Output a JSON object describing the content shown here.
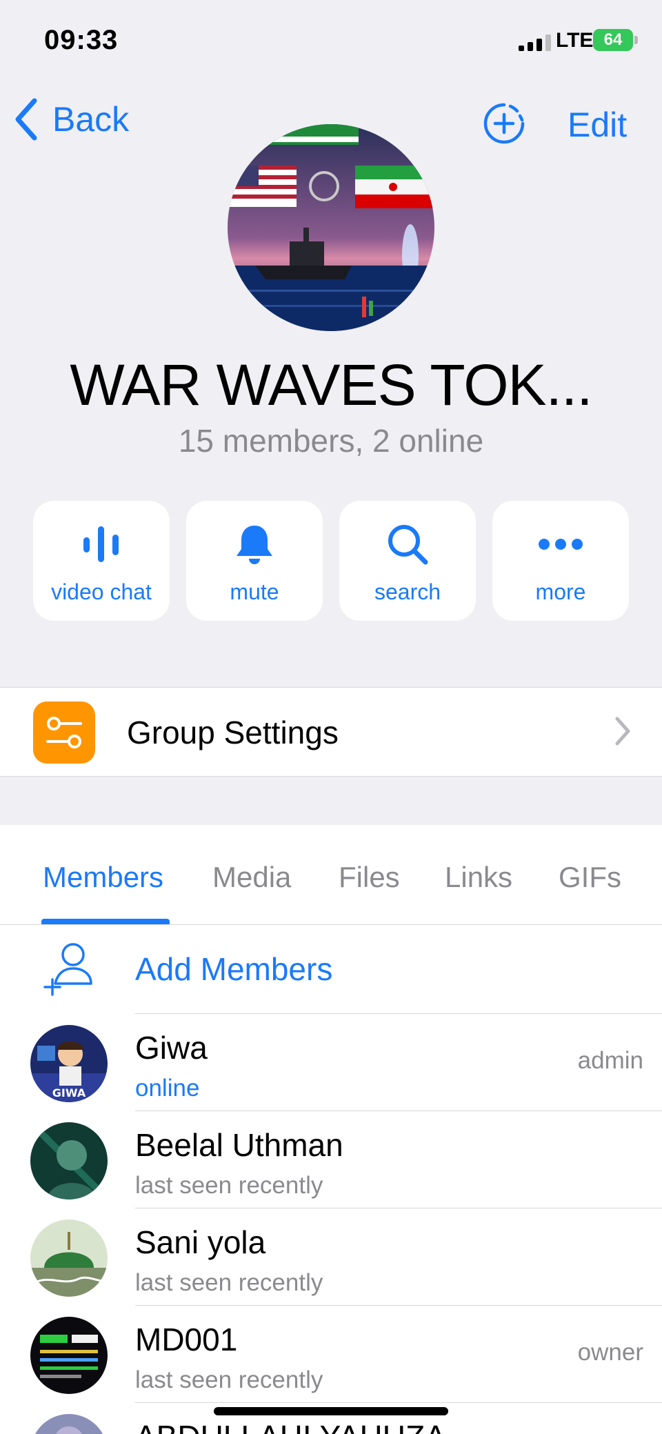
{
  "status_bar": {
    "time": "09:33",
    "network": "LTE",
    "battery": "64"
  },
  "nav": {
    "back_label": "Back",
    "edit_label": "Edit"
  },
  "group": {
    "title": "WAR WAVES TOK...",
    "subtitle": "15 members, 2 online"
  },
  "actions": [
    {
      "label": "video chat",
      "icon": "video-chat-icon"
    },
    {
      "label": "mute",
      "icon": "bell-icon"
    },
    {
      "label": "search",
      "icon": "search-icon"
    },
    {
      "label": "more",
      "icon": "more-icon"
    }
  ],
  "settings": {
    "label": "Group Settings",
    "icon": "sliders-icon"
  },
  "tabs": [
    "Members",
    "Media",
    "Files",
    "Links",
    "GIFs"
  ],
  "add_members": {
    "label": "Add Members"
  },
  "members": [
    {
      "name": "Giwa",
      "status": "online",
      "role": "admin"
    },
    {
      "name": "Beelal Uthman",
      "status": "last seen recently",
      "role": ""
    },
    {
      "name": "Sani yola",
      "status": "last seen recently",
      "role": ""
    },
    {
      "name": "MD001",
      "status": "last seen recently",
      "role": "owner"
    },
    {
      "name": "ABDULLAHI YAHUZA",
      "status": "",
      "role": ""
    }
  ],
  "colors": {
    "accent": "#1a7af8",
    "settings_icon_bg": "#ff9500",
    "background": "#efeff4",
    "battery": "#34c759"
  }
}
